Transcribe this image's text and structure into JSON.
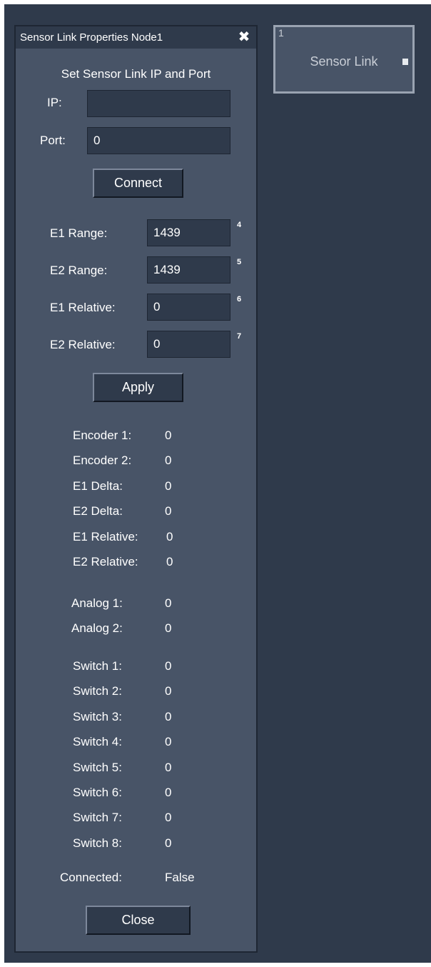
{
  "panel": {
    "title": "Sensor Link Properties Node1",
    "close_glyph": "✖",
    "heading": "Set Sensor Link IP and Port",
    "ip_label": "IP:",
    "ip_value": "",
    "port_label": "Port:",
    "port_value": "0",
    "connect_label": "Connect",
    "range_fields": [
      {
        "label": "E1 Range:",
        "value": "1439",
        "badge": "4"
      },
      {
        "label": "E2 Range:",
        "value": "1439",
        "badge": "5"
      },
      {
        "label": "E1 Relative:",
        "value": "0",
        "badge": "6"
      },
      {
        "label": "E2 Relative:",
        "value": "0",
        "badge": "7"
      }
    ],
    "apply_label": "Apply",
    "encoder_stats": [
      {
        "label": "Encoder 1:",
        "value": "0"
      },
      {
        "label": "Encoder 2:",
        "value": "0"
      },
      {
        "label": "E1 Delta:",
        "value": "0"
      },
      {
        "label": "E2 Delta:",
        "value": "0"
      },
      {
        "label": "E1 Relative:",
        "value": "0"
      },
      {
        "label": "E2 Relative:",
        "value": "0"
      }
    ],
    "analog_stats": [
      {
        "label": "Analog 1:",
        "value": "0"
      },
      {
        "label": "Analog 2:",
        "value": "0"
      }
    ],
    "switch_stats": [
      {
        "label": "Switch 1:",
        "value": "0"
      },
      {
        "label": "Switch 2:",
        "value": "0"
      },
      {
        "label": "Switch 3:",
        "value": "0"
      },
      {
        "label": "Switch 4:",
        "value": "0"
      },
      {
        "label": "Switch 5:",
        "value": "0"
      },
      {
        "label": "Switch 6:",
        "value": "0"
      },
      {
        "label": "Switch 7:",
        "value": "0"
      },
      {
        "label": "Switch 8:",
        "value": "0"
      }
    ],
    "connected_label": "Connected:",
    "connected_value": "False",
    "close_label": "Close"
  },
  "node": {
    "id": "1",
    "label": "Sensor Link"
  },
  "colors": {
    "canvas": "#2f3a4b",
    "panel": "#485467",
    "field": "#2f3a4b",
    "text": "#ffffff"
  }
}
